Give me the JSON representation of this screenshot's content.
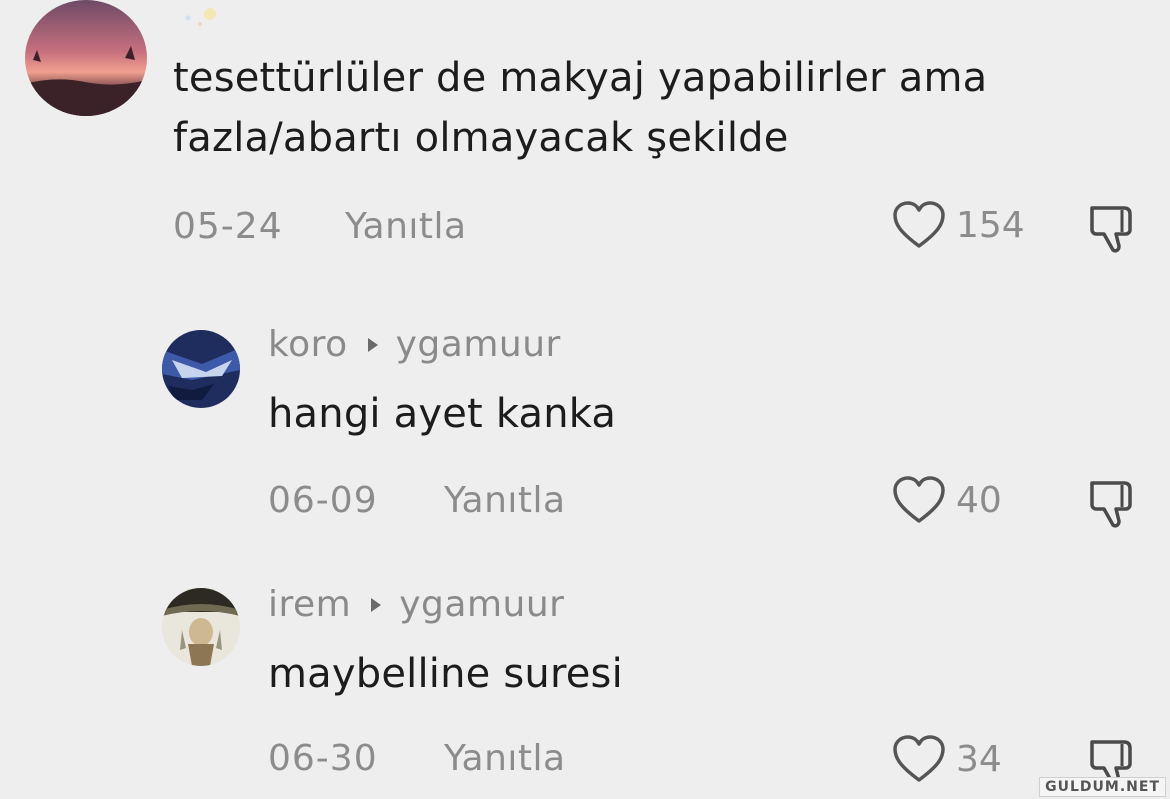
{
  "comments": [
    {
      "text": "tesettürlüler de makyaj yapabilirler ama\nfazla/abartı olmayacak şekilde",
      "date": "05-24",
      "reply_label": "Yanıtla",
      "likes": "154"
    },
    {
      "author": "koro",
      "reply_to": "ygamuur",
      "text": "hangi ayet kanka",
      "date": "06-09",
      "reply_label": "Yanıtla",
      "likes": "40"
    },
    {
      "author": "irem",
      "reply_to": "ygamuur",
      "text": "maybelline suresi",
      "date": "06-30",
      "reply_label": "Yanıtla",
      "likes": "34"
    }
  ],
  "watermark": "GULDUM.NET",
  "icons": {
    "like": "heart-icon",
    "dislike": "thumbs-down-icon",
    "reply_arrow": "triangle-right-icon"
  },
  "colors": {
    "background": "#eeeeee",
    "text": "#1c1c1c",
    "secondary_text": "#8c8c8c"
  }
}
